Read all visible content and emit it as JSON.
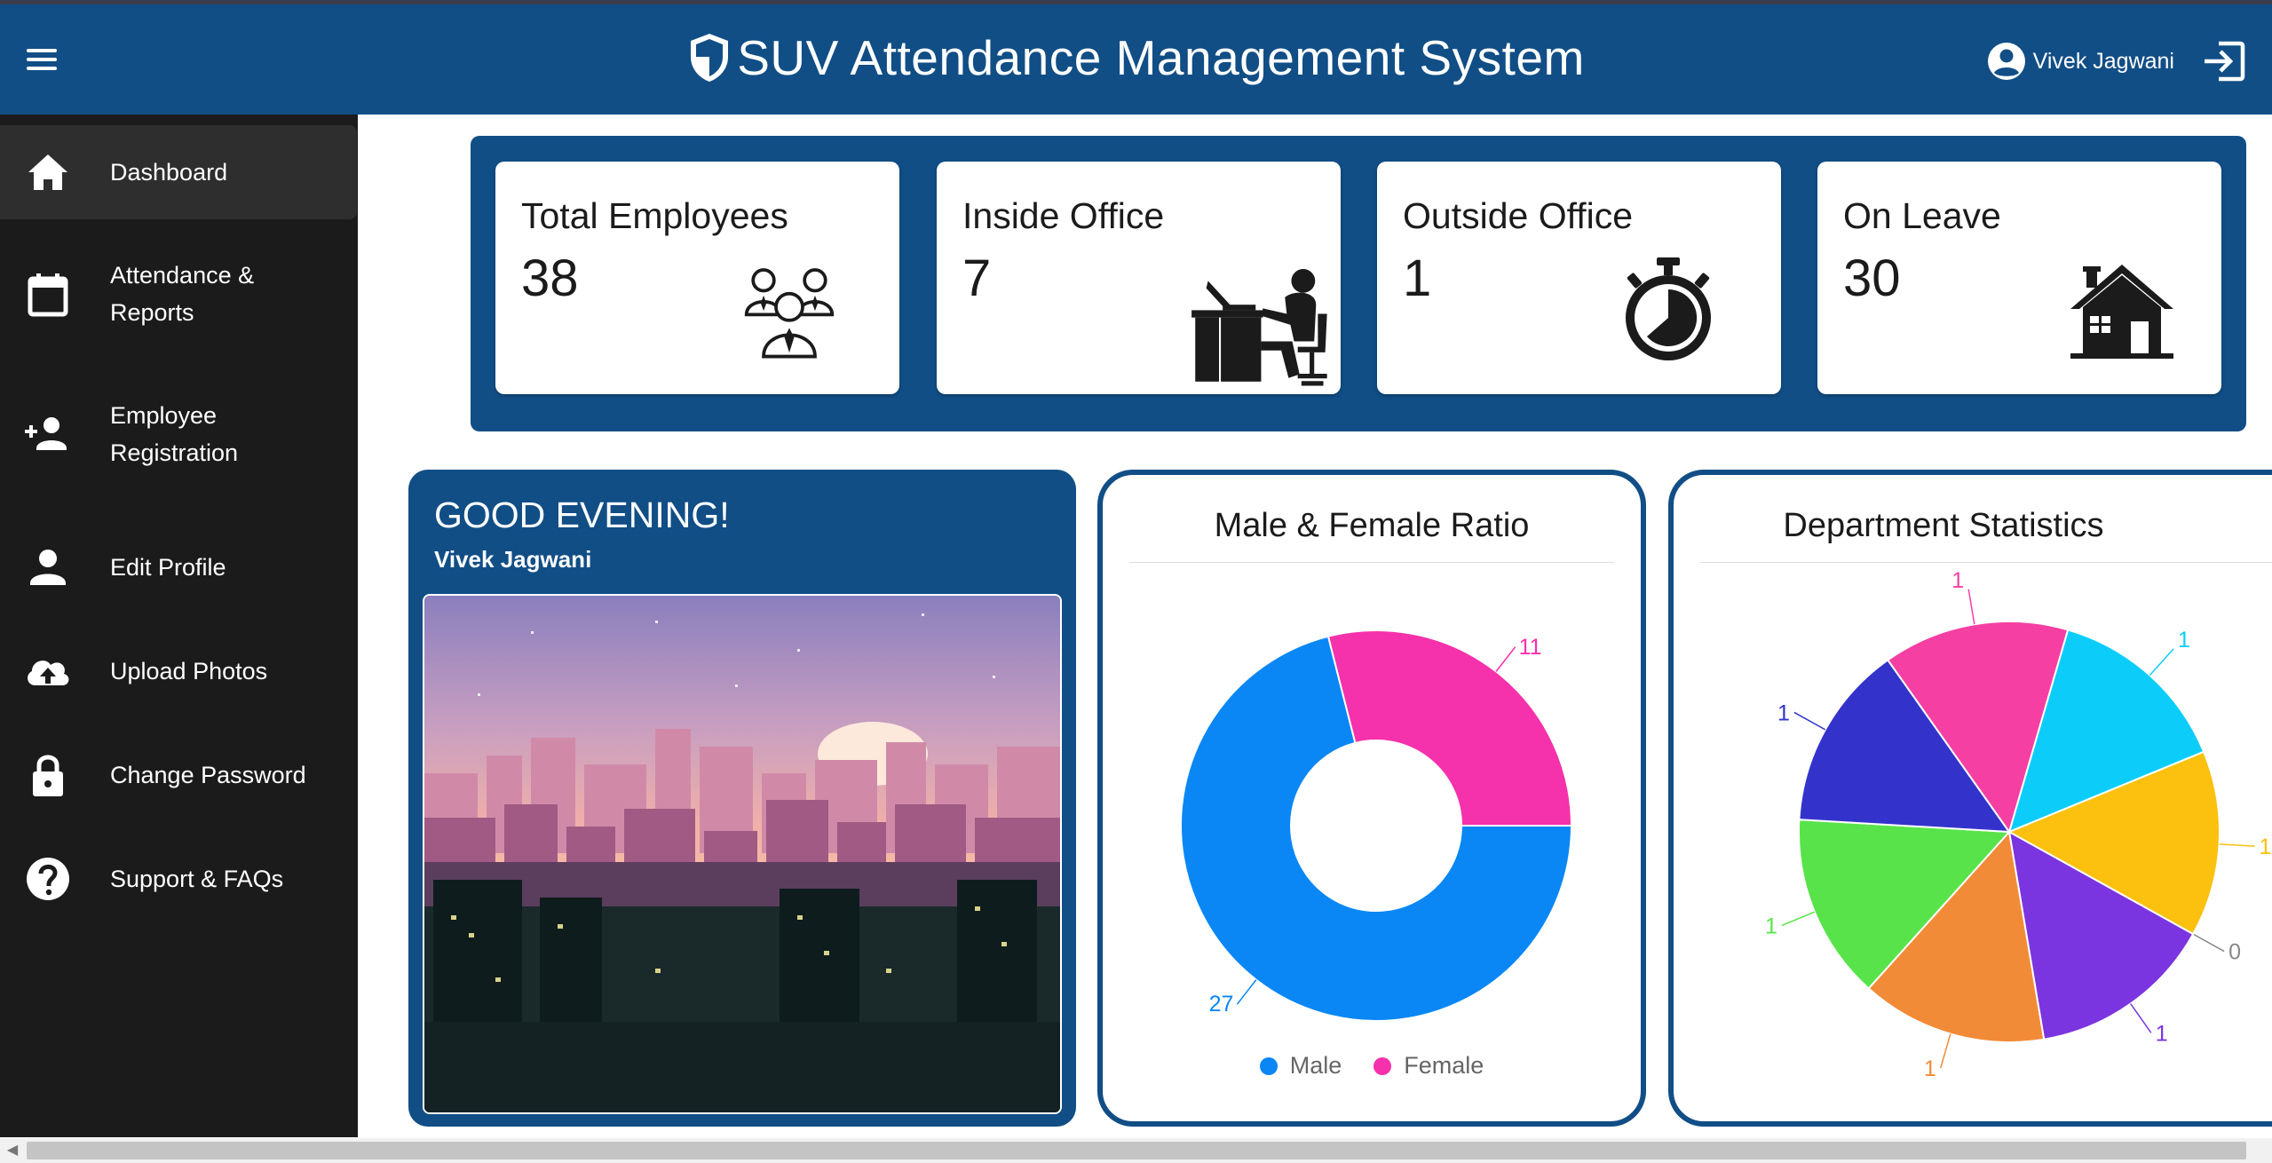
{
  "header": {
    "title": "SUV Attendance Management System",
    "user_name": "Vivek Jagwani",
    "color": "#114e86"
  },
  "sidebar": {
    "items": [
      {
        "label": "Dashboard",
        "icon": "home-icon",
        "active": true
      },
      {
        "label": "Attendance &\nReports",
        "icon": "calendar-icon"
      },
      {
        "label": "Employee\nRegistration",
        "icon": "person-add-icon"
      },
      {
        "label": "Edit Profile",
        "icon": "person-icon"
      },
      {
        "label": "Upload Photos",
        "icon": "cloud-upload-icon"
      },
      {
        "label": "Change Password",
        "icon": "lock-icon"
      },
      {
        "label": "Support & FAQs",
        "icon": "help-icon"
      }
    ]
  },
  "stats": [
    {
      "label": "Total Employees",
      "value": "38",
      "icon": "team-icon"
    },
    {
      "label": "Inside Office",
      "value": "7",
      "icon": "desk-worker-icon"
    },
    {
      "label": "Outside Office",
      "value": "1",
      "icon": "stopwatch-icon"
    },
    {
      "label": "On Leave",
      "value": "30",
      "icon": "house-icon"
    }
  ],
  "greeting": {
    "title": "GOOD EVENING!",
    "name": "Vivek Jagwani"
  },
  "chart_data": [
    {
      "type": "pie",
      "subtype": "donut",
      "title": "Male & Female Ratio",
      "categories": [
        "Male",
        "Female"
      ],
      "values": [
        27,
        11
      ],
      "colors": [
        "#0a87f5",
        "#f531ab"
      ],
      "legend": "bottom"
    },
    {
      "type": "pie",
      "title": "Department Statistics",
      "categories": [
        "",
        "",
        "",
        "",
        "",
        "",
        "",
        ""
      ],
      "values": [
        1,
        1,
        0,
        1,
        1,
        1,
        1,
        1
      ],
      "labels": [
        "1",
        "1",
        "0",
        "1",
        "1",
        "1",
        "1",
        "1"
      ],
      "colors": [
        "#0ccdfa",
        "#fbc10e",
        "#e8e8e8",
        "#7b35e0",
        "#f28b37",
        "#58e34a",
        "#3333cc",
        "#f53fa3"
      ]
    }
  ]
}
